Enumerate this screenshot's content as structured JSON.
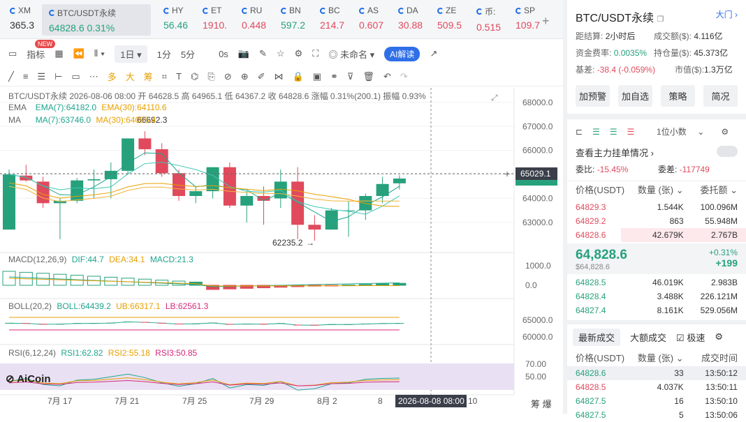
{
  "tickers": [
    {
      "name": "XM",
      "price": "365.3",
      "dir": "dn"
    },
    {
      "name": "BTC/USDT永续",
      "price": "64828.6",
      "chg": "0.31%",
      "dir": "up",
      "selected": true
    },
    {
      "name": "HY",
      "price": "56.46",
      "dir": "up"
    },
    {
      "name": "ET",
      "price": "1910.",
      "dir": "dn"
    },
    {
      "name": "RU",
      "price": "0.448",
      "dir": "dn"
    },
    {
      "name": "BN",
      "price": "597.2",
      "dir": "up"
    },
    {
      "name": "BC",
      "price": "214.7",
      "dir": "dn"
    },
    {
      "name": "AS",
      "price": "0.607",
      "dir": "dn"
    },
    {
      "name": "DA",
      "price": "30.88",
      "dir": "dn"
    },
    {
      "name": "ZE",
      "price": "509.5",
      "dir": "dn"
    },
    {
      "name": "币:",
      "price": "0.515",
      "dir": "dn"
    },
    {
      "name": "SP",
      "price": "109.7",
      "dir": "dn"
    }
  ],
  "toolbar": {
    "indicators": "指标",
    "new_badge": "NEW",
    "interval": "1日",
    "t1": "1分",
    "t2": "5分",
    "t3": "0s",
    "unnamed": "未命名",
    "ai": "AI解读"
  },
  "toolbar2": {
    "bull": "多",
    "big": "大",
    "chip": "筹"
  },
  "legend": {
    "main": "BTC/USDT永续  2026-08-06 08:00 开 64628.5 高 64965.1 低 64367.2 收 64828.6 涨幅 0.31%(200.1) 振幅 0.93%",
    "ema": "EMA",
    "ema7": "EMA(7):64182.0",
    "ema30": "EMA(30):64110.6",
    "ma": "MA",
    "ma7": "MA(7):63746.0",
    "ma30": "MA(30):64095.4",
    "macd": "MACD(12,26,9)",
    "dif": "DIF:44.7",
    "dea": "DEA:34.1",
    "macdv": "MACD:21.3",
    "boll": "BOLL(20,2)",
    "bollv": "BOLL:64439.2",
    "ub": "UB:66317.1",
    "lb": "LB:62561.3",
    "rsi": "RSI(6,12,24)",
    "rsi1": "RSI1:62.82",
    "rsi2": "RSI2:55.18",
    "rsi3": "RSI3:50.85"
  },
  "price_axis": [
    "68000.0",
    "67000.0",
    "66000.0",
    "65000.0",
    "64000.0",
    "63000.0"
  ],
  "current_price_tag": "65029.1",
  "macd_axis": [
    "1000.0",
    "0.0"
  ],
  "boll_axis": [
    "65000.0",
    "60000.0"
  ],
  "rsi_axis": [
    "70.00",
    "50.00"
  ],
  "low_label": "62235.2",
  "high_label": "66692.3",
  "x_labels": [
    "7月 17",
    "7月 21",
    "7月 25",
    "7月 29",
    "8月 2",
    "8"
  ],
  "crosshair_time": "2026-08-08 08:00",
  "x_tail": "10",
  "brand": "AiCoin",
  "corner": {
    "a": "筹",
    "b": "爆"
  },
  "candles": [
    {
      "o": 62700,
      "h": 65200,
      "l": 62700,
      "c": 65000
    },
    {
      "o": 64950,
      "h": 65400,
      "l": 64700,
      "c": 64750
    },
    {
      "o": 64700,
      "h": 64900,
      "l": 63600,
      "c": 63800
    },
    {
      "o": 63800,
      "h": 64000,
      "l": 62300,
      "c": 63900
    },
    {
      "o": 63900,
      "h": 64850,
      "l": 63800,
      "c": 64750
    },
    {
      "o": 64750,
      "h": 65200,
      "l": 64000,
      "c": 64800
    },
    {
      "o": 64800,
      "h": 65500,
      "l": 64000,
      "c": 65150
    },
    {
      "o": 65150,
      "h": 66500,
      "l": 65000,
      "c": 66500
    },
    {
      "o": 66500,
      "h": 66800,
      "l": 65800,
      "c": 66050
    },
    {
      "o": 66050,
      "h": 66300,
      "l": 64900,
      "c": 65050
    },
    {
      "o": 65050,
      "h": 65200,
      "l": 63900,
      "c": 64100
    },
    {
      "o": 64100,
      "h": 64500,
      "l": 63800,
      "c": 64300
    },
    {
      "o": 64300,
      "h": 65300,
      "l": 64000,
      "c": 65300
    },
    {
      "o": 65300,
      "h": 65500,
      "l": 63600,
      "c": 63700
    },
    {
      "o": 63700,
      "h": 64300,
      "l": 63000,
      "c": 64100
    },
    {
      "o": 64100,
      "h": 64500,
      "l": 62900,
      "c": 63900
    },
    {
      "o": 64000,
      "h": 65200,
      "l": 63600,
      "c": 64700
    },
    {
      "o": 64700,
      "h": 65300,
      "l": 62300,
      "c": 62900
    },
    {
      "o": 62900,
      "h": 63300,
      "l": 62235,
      "c": 62700
    },
    {
      "o": 62700,
      "h": 63600,
      "l": 62700,
      "c": 63500
    },
    {
      "o": 63500,
      "h": 63900,
      "l": 62400,
      "c": 63500
    },
    {
      "o": 63500,
      "h": 64200,
      "l": 63100,
      "c": 64100
    },
    {
      "o": 64100,
      "h": 64900,
      "l": 63800,
      "c": 64600
    },
    {
      "o": 64628,
      "h": 64965,
      "l": 64367,
      "c": 64828
    }
  ],
  "panel": {
    "symbol": "BTC/USDT永续",
    "gate": "大门",
    "k1": "距结算:",
    "v1": "2小时后",
    "k2": "成交额($):",
    "v2": "4.116亿",
    "k3": "资金费率:",
    "v3": "0.0035%",
    "k4": "持仓量($):",
    "v4": "45.373亿",
    "k5": "基差:",
    "v5": "-38.4 (-0.059%)",
    "k6": "市值($):",
    "v6": "1.3万亿",
    "a1": "加预警",
    "a2": "加自选",
    "a3": "策略",
    "a4": "简况",
    "unit": "1位小数",
    "main_order": "查看主力挂单情况",
    "wb_label": "委比:",
    "wb": "-15.45%",
    "wc_label": "委差:",
    "wc": "-117749",
    "ob_h1": "价格(USDT)",
    "ob_h2": "数量 (张)",
    "ob_h3": "委托额",
    "asks": [
      [
        "64829.3",
        "1.544K",
        "100.096M"
      ],
      [
        "64829.2",
        "863",
        "55.948M"
      ],
      [
        "64828.6",
        "42.679K",
        "2.767B"
      ]
    ],
    "last": "64,828.6",
    "last_usd": "$64,828.6",
    "pct": "+0.31%",
    "chg": "+199",
    "bids": [
      [
        "64828.5",
        "46.019K",
        "2.983B"
      ],
      [
        "64828.4",
        "3.488K",
        "226.121M"
      ],
      [
        "64827.4",
        "8.161K",
        "529.056M"
      ]
    ],
    "tab1": "最新成交",
    "tab2": "大额成交",
    "tab3": "极速",
    "tr_h1": "价格(USDT)",
    "tr_h2": "数量 (张)",
    "tr_h3": "成交时间",
    "trades": [
      [
        "64828.6",
        "33",
        "13:50:12",
        "up"
      ],
      [
        "64828.5",
        "4.037K",
        "13:50:11",
        "dn"
      ],
      [
        "64827.5",
        "16",
        "13:50:10",
        "up"
      ],
      [
        "64827.5",
        "5",
        "13:50:06",
        "up"
      ]
    ]
  }
}
